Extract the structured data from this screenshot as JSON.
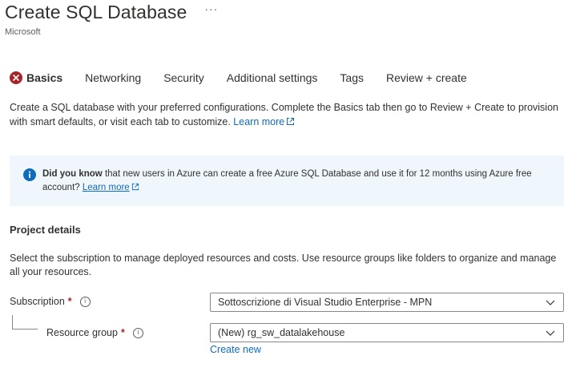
{
  "header": {
    "title": "Create SQL Database",
    "more": "···",
    "publisher": "Microsoft"
  },
  "tabs": [
    {
      "label": "Basics",
      "active": true,
      "error": true
    },
    {
      "label": "Networking"
    },
    {
      "label": "Security"
    },
    {
      "label": "Additional settings"
    },
    {
      "label": "Tags"
    },
    {
      "label": "Review + create"
    }
  ],
  "intro": {
    "text": "Create a SQL database with your preferred configurations. Complete the Basics tab then go to Review + Create to provision with smart defaults, or visit each tab to customize.",
    "link": "Learn more"
  },
  "info": {
    "bold": "Did you know",
    "text": "that new users in Azure can create a free Azure SQL Database and use it for 12 months using Azure free account?",
    "link": "Learn more"
  },
  "project": {
    "title": "Project details",
    "description": "Select the subscription to manage deployed resources and costs. Use resource groups like folders to organize and manage all your resources.",
    "subscription": {
      "label": "Subscription",
      "required": "*",
      "value": "Sottoscrizione di Visual Studio Enterprise - MPN"
    },
    "resource_group": {
      "label": "Resource group",
      "required": "*",
      "value": "(New) rg_sw_datalakehouse",
      "create_new": "Create new"
    }
  },
  "colors": {
    "accent": "#0f6cbd",
    "error": "#a4262c",
    "info_bg": "#eff6fc",
    "text": "#323130"
  }
}
